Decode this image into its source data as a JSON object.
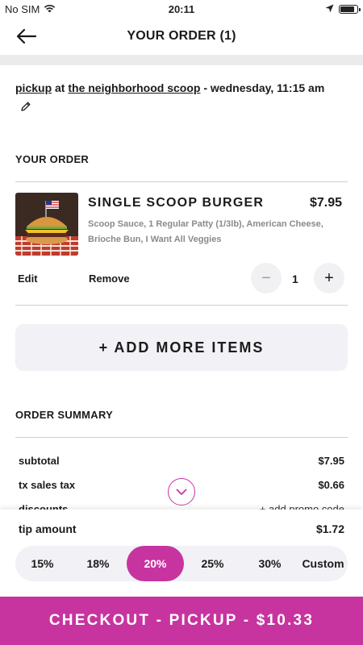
{
  "status_bar": {
    "carrier": "No SIM",
    "time": "20:11",
    "battery_level": 0.9
  },
  "header": {
    "title": "YOUR ORDER (1)"
  },
  "pickup": {
    "method": "pickup",
    "at_text": "at",
    "location": "the neighborhood scoop",
    "when": "- wednesday, 11:15 am"
  },
  "order": {
    "section_title": "YOUR ORDER",
    "item": {
      "name": "SINGLE SCOOP BURGER",
      "price": "$7.95",
      "description": "Scoop Sauce, 1 Regular Patty (1/3lb), American Cheese, Brioche Bun, I Want All Veggies",
      "edit_label": "Edit",
      "remove_label": "Remove",
      "quantity": "1",
      "minus_label": "−",
      "plus_label": "+"
    },
    "add_more_label": "+ ADD MORE ITEMS"
  },
  "summary": {
    "section_title": "ORDER SUMMARY",
    "subtotal_label": "subtotal",
    "subtotal_value": "$7.95",
    "tax_label": "tx sales tax",
    "tax_value": "$0.66",
    "discounts_label": "discounts",
    "promo_label": "+ add promo code"
  },
  "tip": {
    "label": "tip amount",
    "value": "$1.72",
    "options": [
      "15%",
      "18%",
      "20%",
      "25%",
      "30%",
      "Custom"
    ],
    "selected": "20%"
  },
  "checkout": {
    "label": "CHECKOUT - PICKUP - $10.33"
  },
  "colors": {
    "accent": "#c7349f",
    "band": "#ebebeb",
    "pill_bg": "#f1f1f6"
  }
}
